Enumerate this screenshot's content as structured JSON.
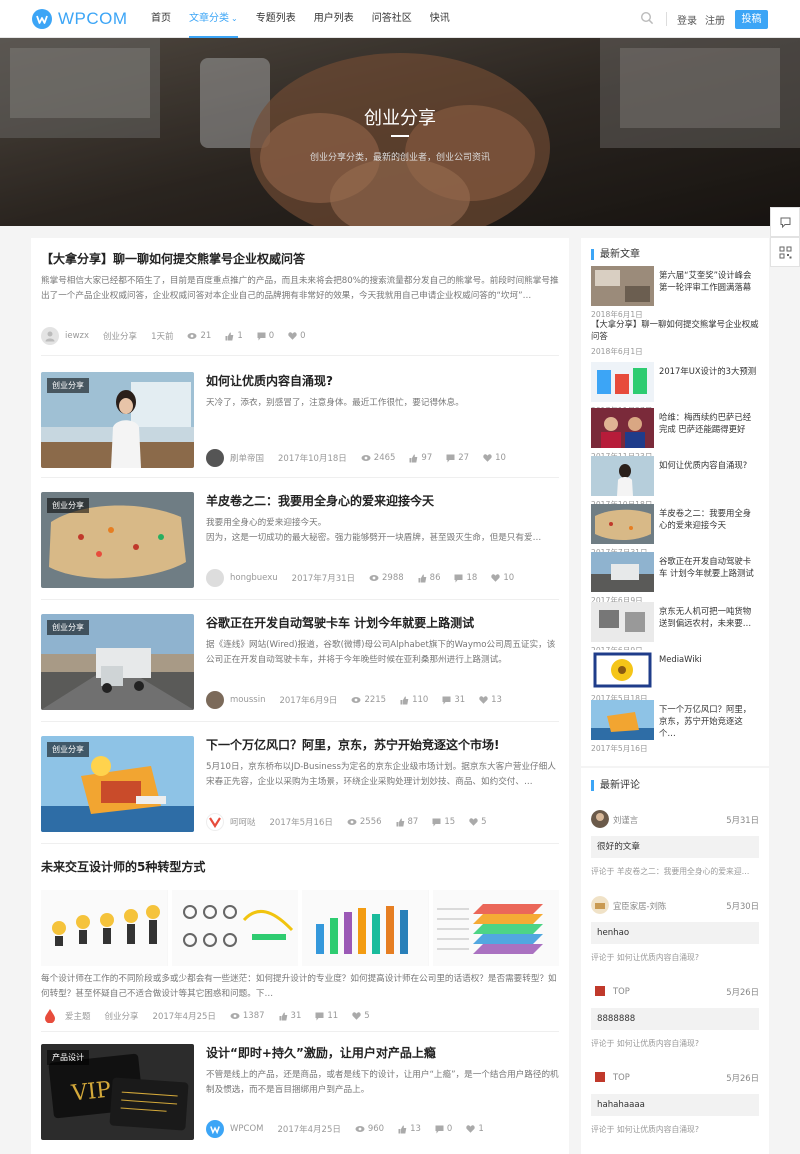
{
  "header": {
    "logo_text": "WPCOM",
    "nav": [
      {
        "label": "首页",
        "active": false
      },
      {
        "label": "文章分类",
        "active": true,
        "caret": "⌄"
      },
      {
        "label": "专题列表",
        "active": false
      },
      {
        "label": "用户列表",
        "active": false
      },
      {
        "label": "问答社区",
        "active": false
      },
      {
        "label": "快讯",
        "active": false
      }
    ],
    "login": "登录",
    "register": "注册",
    "post_button": "投稿"
  },
  "banner": {
    "title": "创业分享",
    "desc": "创业分享分类，最新的创业者，创业公司资讯"
  },
  "colors": {
    "accent": "#3ca5f6"
  },
  "posts": [
    {
      "title": "【大拿分享】聊一聊如何提交熊掌号企业权威问答",
      "excerpt": "熊掌号相信大家已经都不陌生了，目前是百度重点推广的产品，而且未来将会把80%的搜索流量都分发自己的熊掌号。前段时间熊掌号推出了一个产品企业权威问答，企业权威问答对本企业自己的品牌拥有非常好的效果，今天我就用自己申请企业权威问答的“坎坷”…",
      "author": "iewzx",
      "category": "创业分享",
      "time": "1天前",
      "views": "21",
      "likes": "1",
      "comments": "0",
      "favs": "0"
    },
    {
      "title": "如何让优质内容自涌现?",
      "tag": "创业分享",
      "excerpt": "天冷了，添衣，别感冒了，注意身体。最近工作很忙，要记得休息。",
      "author": "刷单帝国",
      "time": "2017年10月18日",
      "views": "2465",
      "likes": "97",
      "comments": "27",
      "favs": "10"
    },
    {
      "title": "羊皮卷之二：我要用全身心的爱来迎接今天",
      "tag": "创业分享",
      "excerpt": "我要用全身心的爱来迎接今天。\n因为，这是一切成功的最大秘密。强力能够劈开一块盾牌，甚至毁灭生命，但是只有爱…",
      "author": "hongbuexu",
      "time": "2017年7月31日",
      "views": "2988",
      "likes": "86",
      "comments": "18",
      "favs": "10"
    },
    {
      "title": "谷歌正在开发自动驾驶卡车 计划今年就要上路测试",
      "tag": "创业分享",
      "excerpt": "据《连线》网站(Wired)报道，谷歌(微博)母公司Alphabet旗下的Waymo公司周五证实，该公司正在开发自动驾驶卡车，并将于今年晚些时候在亚利桑那州进行上路测试。",
      "author": "moussin",
      "time": "2017年6月9日",
      "views": "2215",
      "likes": "110",
      "comments": "31",
      "favs": "13"
    },
    {
      "title": "下一个万亿风口？阿里，京东，苏宁开始竞逐这个市场!",
      "tag": "创业分享",
      "excerpt": "5月10日，京东桥布以JD-Business为定名的京东企业级市场计划。据京东大客户营业仔细人宋春正先容，企业以采购为主场景，环绕企业采购处理计划妙技、商品、如约交付、…",
      "author": "呵呵哒",
      "time": "2017年5月16日",
      "views": "2556",
      "likes": "87",
      "comments": "15",
      "favs": "5"
    },
    {
      "title": "未来交互设计师的5种转型方式",
      "excerpt": "每个设计师在工作的不同阶段或多或少都会有一些迷茫：如何提升设计的专业度？如何提高设计师在公司里的话语权？是否需要转型？如何转型？甚至怀疑自己不适合做设计等其它困惑和问题。下…",
      "author": "爱主题",
      "category": "创业分享",
      "time": "2017年4月25日",
      "views": "1387",
      "likes": "31",
      "comments": "11",
      "favs": "5"
    },
    {
      "title": "设计“即时+持久”激励，让用户对产品上瘾",
      "tag": "产品设计",
      "excerpt": "不管是线上的产品，还是商品，或者是线下的设计，让用户“上瘾”，是一个结合用户路径的机制及惯选，而不是盲目捆绑用户到产品上。",
      "author": "WPCOM",
      "time": "2017年4月25日",
      "views": "960",
      "likes": "13",
      "comments": "0",
      "favs": "1"
    }
  ],
  "sidebar": {
    "latest_title": "最新文章",
    "latest": [
      {
        "title": "第六届“艾奎奖”设计峰会第一轮评审工作圆满落幕",
        "date": "2018年6月1日",
        "thumb": true
      },
      {
        "title": "【大拿分享】聊一聊如何提交熊掌号企业权威问答",
        "date": "2018年6月1日",
        "thumb": false
      },
      {
        "title": "2017年UX设计的3大预测",
        "date": "2017年11月27日",
        "thumb": true
      },
      {
        "title": "哈维：梅西续约巴萨已经完成 巴萨还能踢得更好",
        "date": "2017年11月23日",
        "thumb": true
      },
      {
        "title": "如何让优质内容自涌现?",
        "date": "2017年10月18日",
        "thumb": true
      },
      {
        "title": "羊皮卷之二：我要用全身心的爱来迎接今天",
        "date": "2017年7月31日",
        "thumb": true
      },
      {
        "title": "谷歌正在开发自动驾驶卡车 计划今年就要上路测试",
        "date": "2017年6月9日",
        "thumb": true
      },
      {
        "title": "京东无人机可把一吨货物送到偏远农村，未来要…",
        "date": "2017年6月9日",
        "thumb": true
      },
      {
        "title": "MediaWiki",
        "date": "2017年5月18日",
        "thumb": true
      },
      {
        "title": "下一个万亿风口？阿里，京东，苏宁开始竞逐这个…",
        "date": "2017年5月16日",
        "thumb": true
      }
    ],
    "comments_title": "最新评论",
    "comments": [
      {
        "name": "刘谨言",
        "date": "5月31日",
        "text": "很好的文章",
        "ref": "评论于 羊皮卷之二：我要用全身心的爱来迎…"
      },
      {
        "name": "宜臣家居-刘陈",
        "date": "5月30日",
        "text": "henhao",
        "ref": "评论于 如何让优质内容自涌现?"
      },
      {
        "name": "TOP",
        "date": "5月26日",
        "text": "8888888",
        "ref": "评论于 如何让优质内容自涌现?"
      },
      {
        "name": "TOP",
        "date": "5月26日",
        "text": "hahahaaaa",
        "ref": "评论于 如何让优质内容自涌现?"
      }
    ]
  }
}
